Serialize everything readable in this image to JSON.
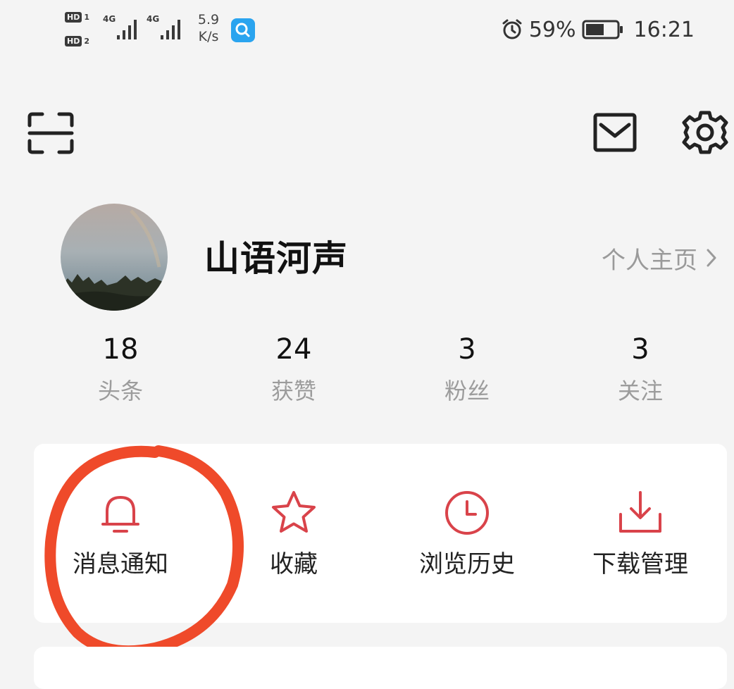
{
  "status_bar": {
    "sim1_label": "HD",
    "sim1_num": "1",
    "sim2_label": "HD",
    "sim2_num": "2",
    "network1": "4G",
    "network2": "4G",
    "net_speed_value": "5.9",
    "net_speed_unit": "K/s",
    "battery_percent": "59%",
    "battery_level": 0.59,
    "time": "16:21",
    "icons": [
      "alarm-icon",
      "battery-icon",
      "search-app-icon"
    ]
  },
  "top_bar": {
    "icons": [
      "scan-icon",
      "mail-icon",
      "settings-icon"
    ]
  },
  "profile": {
    "username": "山语河声",
    "homepage_link": "个人主页",
    "chevron": "›"
  },
  "stats": [
    {
      "value": "18",
      "label": "头条"
    },
    {
      "value": "24",
      "label": "获赞"
    },
    {
      "value": "3",
      "label": "粉丝"
    },
    {
      "value": "3",
      "label": "关注"
    }
  ],
  "quick_actions": [
    {
      "label": "消息通知",
      "icon": "bell-icon"
    },
    {
      "label": "收藏",
      "icon": "star-icon"
    },
    {
      "label": "浏览历史",
      "icon": "clock-icon"
    },
    {
      "label": "下载管理",
      "icon": "download-icon"
    }
  ],
  "colors": {
    "accent": "#d9434a",
    "annotation": "#ef4a2a",
    "background": "#f4f4f4",
    "card": "#ffffff",
    "muted_text": "#9c9c9c"
  }
}
